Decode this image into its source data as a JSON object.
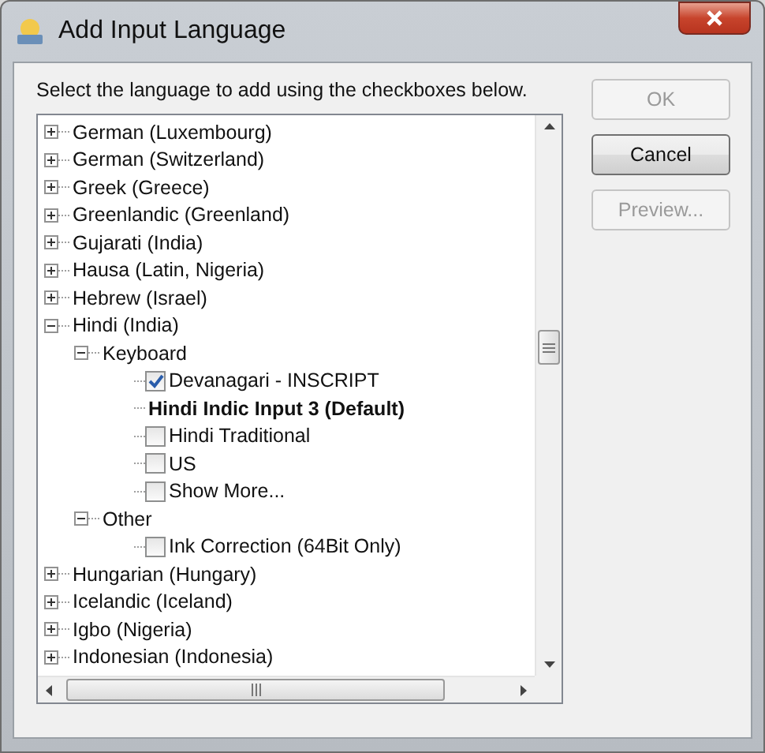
{
  "window": {
    "title": "Add Input Language"
  },
  "instruction": "Select the language to add using the checkboxes below.",
  "tree": [
    {
      "kind": "group",
      "label": "German (Luxembourg)",
      "expanded": false
    },
    {
      "kind": "group",
      "label": "German (Switzerland)",
      "expanded": false
    },
    {
      "kind": "group",
      "label": "Greek (Greece)",
      "expanded": false
    },
    {
      "kind": "group",
      "label": "Greenlandic (Greenland)",
      "expanded": false
    },
    {
      "kind": "group",
      "label": "Gujarati (India)",
      "expanded": false
    },
    {
      "kind": "group",
      "label": "Hausa (Latin, Nigeria)",
      "expanded": false
    },
    {
      "kind": "group",
      "label": "Hebrew (Israel)",
      "expanded": false
    },
    {
      "kind": "group",
      "label": "Hindi (India)",
      "expanded": true,
      "children": [
        {
          "kind": "group",
          "label": "Keyboard",
          "expanded": true,
          "children": [
            {
              "kind": "checkbox",
              "label": "Devanagari - INSCRIPT",
              "checked": true
            },
            {
              "kind": "default",
              "label": "Hindi Indic Input 3 (Default)"
            },
            {
              "kind": "checkbox",
              "label": "Hindi Traditional",
              "checked": false
            },
            {
              "kind": "checkbox",
              "label": "US",
              "checked": false
            },
            {
              "kind": "checkbox",
              "label": "Show More...",
              "checked": false
            }
          ]
        },
        {
          "kind": "group",
          "label": "Other",
          "expanded": true,
          "children": [
            {
              "kind": "checkbox",
              "label": "Ink Correction (64Bit Only)",
              "checked": false
            }
          ]
        }
      ]
    },
    {
      "kind": "group",
      "label": "Hungarian (Hungary)",
      "expanded": false
    },
    {
      "kind": "group",
      "label": "Icelandic (Iceland)",
      "expanded": false
    },
    {
      "kind": "group",
      "label": "Igbo (Nigeria)",
      "expanded": false
    },
    {
      "kind": "group",
      "label": "Indonesian (Indonesia)",
      "expanded": false
    }
  ],
  "buttons": [
    {
      "label": "OK",
      "disabled": true
    },
    {
      "label": "Cancel",
      "disabled": false
    },
    {
      "label": "Preview...",
      "disabled": true
    }
  ]
}
